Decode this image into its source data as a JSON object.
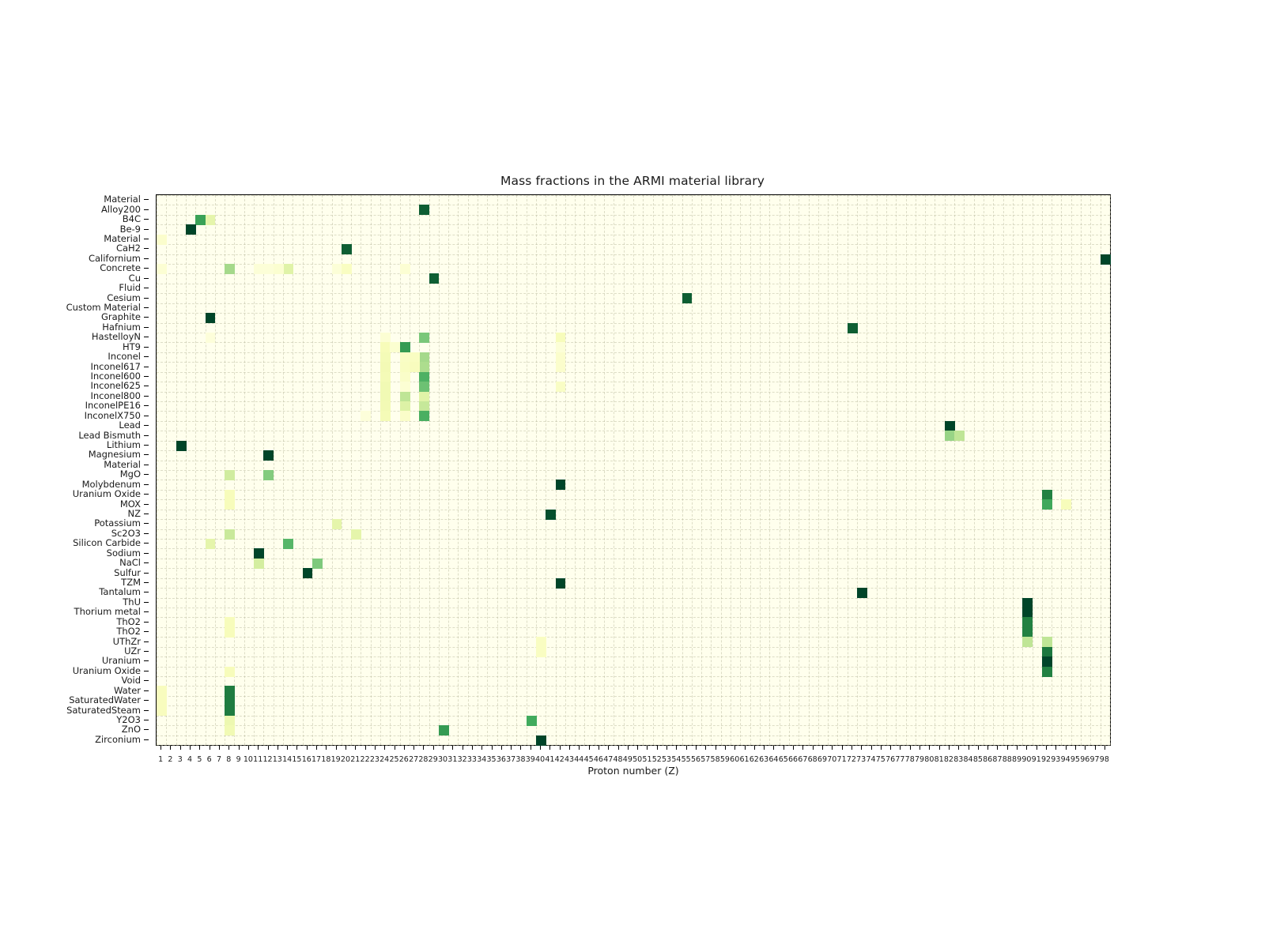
{
  "chart_data": {
    "type": "heatmap",
    "title": "Mass fractions in the ARMI material library",
    "xlabel": "Proton number (Z)",
    "ylabel": "",
    "colormap": "YlGn",
    "grid": true,
    "legend": "none",
    "background_color": "#ffffed",
    "xlim": [
      1,
      98
    ],
    "x": [
      1,
      2,
      3,
      4,
      5,
      6,
      7,
      8,
      9,
      10,
      11,
      12,
      13,
      14,
      15,
      16,
      17,
      18,
      19,
      20,
      21,
      22,
      23,
      24,
      25,
      26,
      27,
      28,
      29,
      30,
      31,
      32,
      33,
      34,
      35,
      36,
      37,
      38,
      39,
      40,
      41,
      42,
      43,
      44,
      45,
      46,
      47,
      48,
      49,
      50,
      51,
      52,
      53,
      54,
      55,
      56,
      57,
      58,
      59,
      60,
      61,
      62,
      63,
      64,
      65,
      66,
      67,
      68,
      69,
      70,
      71,
      72,
      73,
      74,
      75,
      76,
      77,
      78,
      79,
      80,
      81,
      82,
      83,
      84,
      85,
      86,
      87,
      88,
      89,
      90,
      91,
      92,
      93,
      94,
      95,
      96,
      97,
      98
    ],
    "xticklabels": [
      "1",
      "2",
      "3",
      "4",
      "5",
      "6",
      "7",
      "8",
      "9",
      "10",
      "11",
      "12",
      "13",
      "14",
      "15",
      "16",
      "17",
      "18",
      "19",
      "20",
      "21",
      "22",
      "23",
      "24",
      "25",
      "26",
      "27",
      "28",
      "29",
      "30",
      "31",
      "32",
      "33",
      "34",
      "35",
      "36",
      "37",
      "38",
      "39",
      "40",
      "41",
      "42",
      "43",
      "44",
      "45",
      "46",
      "47",
      "48",
      "49",
      "50",
      "51",
      "52",
      "53",
      "54",
      "55",
      "56",
      "57",
      "58",
      "59",
      "60",
      "61",
      "62",
      "63",
      "64",
      "65",
      "66",
      "67",
      "68",
      "69",
      "70",
      "71",
      "72",
      "73",
      "74",
      "75",
      "76",
      "77",
      "78",
      "79",
      "80",
      "81",
      "82",
      "83",
      "84",
      "85",
      "86",
      "87",
      "88",
      "89",
      "90",
      "91",
      "92",
      "93",
      "94",
      "95",
      "96",
      "97",
      "98"
    ],
    "yticklabels": [
      "Material",
      "Alloy200",
      "B4C",
      "Be-9",
      "Material",
      "CaH2",
      "Californium",
      "Concrete",
      "Cu",
      "Fluid",
      "Cesium",
      "Custom Material",
      "Graphite",
      "Hafnium",
      "HastelloyN",
      "HT9",
      "Inconel",
      "Inconel617",
      "Inconel600",
      "Inconel625",
      "Inconel800",
      "InconelPE16",
      "InconelX750",
      "Lead",
      "Lead Bismuth",
      "Lithium",
      "Magnesium",
      "Material",
      "MgO",
      "Molybdenum",
      "Uranium Oxide",
      "MOX",
      "NZ",
      "Potassium",
      "Sc2O3",
      "Silicon Carbide",
      "Sodium",
      "NaCl",
      "Sulfur",
      "TZM",
      "Tantalum",
      "ThU",
      "Thorium metal",
      "ThO2",
      "ThO2",
      "UThZr",
      "UZr",
      "Uranium",
      "Uranium Oxide",
      "Void",
      "Water",
      "SaturatedWater",
      "SaturatedSteam",
      "Y2O3",
      "ZnO",
      "Zirconium"
    ],
    "cells": [
      {
        "row": 1,
        "col": 28,
        "v": 0.95
      },
      {
        "row": 2,
        "col": 5,
        "v": 0.78
      },
      {
        "row": 2,
        "col": 6,
        "v": 0.3
      },
      {
        "row": 3,
        "col": 4,
        "v": 1.0
      },
      {
        "row": 4,
        "col": 1,
        "v": 0.07
      },
      {
        "row": 5,
        "col": 20,
        "v": 0.95
      },
      {
        "row": 6,
        "col": 98,
        "v": 1.0
      },
      {
        "row": 7,
        "col": 8,
        "v": 0.52
      },
      {
        "row": 7,
        "col": 14,
        "v": 0.33
      },
      {
        "row": 7,
        "col": 1,
        "v": 0.05
      },
      {
        "row": 7,
        "col": 11,
        "v": 0.04
      },
      {
        "row": 7,
        "col": 12,
        "v": 0.04
      },
      {
        "row": 7,
        "col": 13,
        "v": 0.06
      },
      {
        "row": 7,
        "col": 19,
        "v": 0.04
      },
      {
        "row": 7,
        "col": 20,
        "v": 0.1
      },
      {
        "row": 7,
        "col": 26,
        "v": 0.05
      },
      {
        "row": 8,
        "col": 29,
        "v": 0.95
      },
      {
        "row": 10,
        "col": 55,
        "v": 0.95
      },
      {
        "row": 12,
        "col": 6,
        "v": 1.0
      },
      {
        "row": 13,
        "col": 72,
        "v": 0.95
      },
      {
        "row": 14,
        "col": 28,
        "v": 0.62
      },
      {
        "row": 14,
        "col": 42,
        "v": 0.12
      },
      {
        "row": 14,
        "col": 24,
        "v": 0.05
      },
      {
        "row": 14,
        "col": 6,
        "v": 0.03
      },
      {
        "row": 15,
        "col": 26,
        "v": 0.8
      },
      {
        "row": 15,
        "col": 24,
        "v": 0.13
      },
      {
        "row": 15,
        "col": 25,
        "v": 0.06
      },
      {
        "row": 15,
        "col": 42,
        "v": 0.04
      },
      {
        "row": 16,
        "col": 28,
        "v": 0.52
      },
      {
        "row": 16,
        "col": 24,
        "v": 0.16
      },
      {
        "row": 16,
        "col": 26,
        "v": 0.09
      },
      {
        "row": 16,
        "col": 27,
        "v": 0.1
      },
      {
        "row": 16,
        "col": 42,
        "v": 0.07
      },
      {
        "row": 17,
        "col": 28,
        "v": 0.5
      },
      {
        "row": 17,
        "col": 24,
        "v": 0.18
      },
      {
        "row": 17,
        "col": 26,
        "v": 0.1
      },
      {
        "row": 17,
        "col": 27,
        "v": 0.11
      },
      {
        "row": 17,
        "col": 42,
        "v": 0.07
      },
      {
        "row": 18,
        "col": 28,
        "v": 0.72
      },
      {
        "row": 18,
        "col": 24,
        "v": 0.16
      },
      {
        "row": 18,
        "col": 26,
        "v": 0.08
      },
      {
        "row": 19,
        "col": 28,
        "v": 0.65
      },
      {
        "row": 19,
        "col": 24,
        "v": 0.2
      },
      {
        "row": 19,
        "col": 26,
        "v": 0.05
      },
      {
        "row": 19,
        "col": 42,
        "v": 0.09
      },
      {
        "row": 20,
        "col": 26,
        "v": 0.45
      },
      {
        "row": 20,
        "col": 28,
        "v": 0.33
      },
      {
        "row": 20,
        "col": 24,
        "v": 0.2
      },
      {
        "row": 21,
        "col": 28,
        "v": 0.43
      },
      {
        "row": 21,
        "col": 26,
        "v": 0.35
      },
      {
        "row": 21,
        "col": 24,
        "v": 0.19
      },
      {
        "row": 22,
        "col": 28,
        "v": 0.73
      },
      {
        "row": 22,
        "col": 24,
        "v": 0.16
      },
      {
        "row": 22,
        "col": 26,
        "v": 0.08
      },
      {
        "row": 22,
        "col": 22,
        "v": 0.03
      },
      {
        "row": 23,
        "col": 82,
        "v": 1.0
      },
      {
        "row": 24,
        "col": 82,
        "v": 0.55
      },
      {
        "row": 24,
        "col": 83,
        "v": 0.45
      },
      {
        "row": 25,
        "col": 3,
        "v": 1.0
      },
      {
        "row": 26,
        "col": 12,
        "v": 1.0
      },
      {
        "row": 28,
        "col": 8,
        "v": 0.4
      },
      {
        "row": 28,
        "col": 12,
        "v": 0.6
      },
      {
        "row": 29,
        "col": 42,
        "v": 1.0
      },
      {
        "row": 30,
        "col": 8,
        "v": 0.12
      },
      {
        "row": 30,
        "col": 92,
        "v": 0.88
      },
      {
        "row": 31,
        "col": 8,
        "v": 0.12
      },
      {
        "row": 31,
        "col": 92,
        "v": 0.76
      },
      {
        "row": 31,
        "col": 94,
        "v": 0.12
      },
      {
        "row": 32,
        "col": 41,
        "v": 0.98
      },
      {
        "row": 33,
        "col": 19,
        "v": 0.3
      },
      {
        "row": 34,
        "col": 8,
        "v": 0.42
      },
      {
        "row": 34,
        "col": 21,
        "v": 0.3
      },
      {
        "row": 35,
        "col": 6,
        "v": 0.3
      },
      {
        "row": 35,
        "col": 14,
        "v": 0.7
      },
      {
        "row": 36,
        "col": 11,
        "v": 1.0
      },
      {
        "row": 37,
        "col": 11,
        "v": 0.39
      },
      {
        "row": 37,
        "col": 17,
        "v": 0.61
      },
      {
        "row": 38,
        "col": 16,
        "v": 1.0
      },
      {
        "row": 39,
        "col": 42,
        "v": 1.0
      },
      {
        "row": 40,
        "col": 73,
        "v": 1.0
      },
      {
        "row": 41,
        "col": 90,
        "v": 1.0
      },
      {
        "row": 42,
        "col": 90,
        "v": 1.0
      },
      {
        "row": 43,
        "col": 8,
        "v": 0.12
      },
      {
        "row": 43,
        "col": 90,
        "v": 0.88
      },
      {
        "row": 44,
        "col": 8,
        "v": 0.12
      },
      {
        "row": 44,
        "col": 90,
        "v": 0.88
      },
      {
        "row": 45,
        "col": 40,
        "v": 0.1
      },
      {
        "row": 45,
        "col": 90,
        "v": 0.45
      },
      {
        "row": 45,
        "col": 92,
        "v": 0.45
      },
      {
        "row": 46,
        "col": 40,
        "v": 0.1
      },
      {
        "row": 46,
        "col": 92,
        "v": 0.9
      },
      {
        "row": 47,
        "col": 92,
        "v": 1.0
      },
      {
        "row": 48,
        "col": 8,
        "v": 0.12
      },
      {
        "row": 48,
        "col": 92,
        "v": 0.88
      },
      {
        "row": 50,
        "col": 1,
        "v": 0.11
      },
      {
        "row": 50,
        "col": 8,
        "v": 0.89
      },
      {
        "row": 51,
        "col": 1,
        "v": 0.11
      },
      {
        "row": 51,
        "col": 8,
        "v": 0.89
      },
      {
        "row": 52,
        "col": 1,
        "v": 0.11
      },
      {
        "row": 52,
        "col": 8,
        "v": 0.89
      },
      {
        "row": 53,
        "col": 8,
        "v": 0.25
      },
      {
        "row": 53,
        "col": 39,
        "v": 0.75
      },
      {
        "row": 54,
        "col": 8,
        "v": 0.2
      },
      {
        "row": 54,
        "col": 30,
        "v": 0.8
      },
      {
        "row": 55,
        "col": 40,
        "v": 1.0
      }
    ]
  },
  "axes": {
    "xtick_step_label": 1,
    "xlabel": "Proton number (Z)"
  }
}
